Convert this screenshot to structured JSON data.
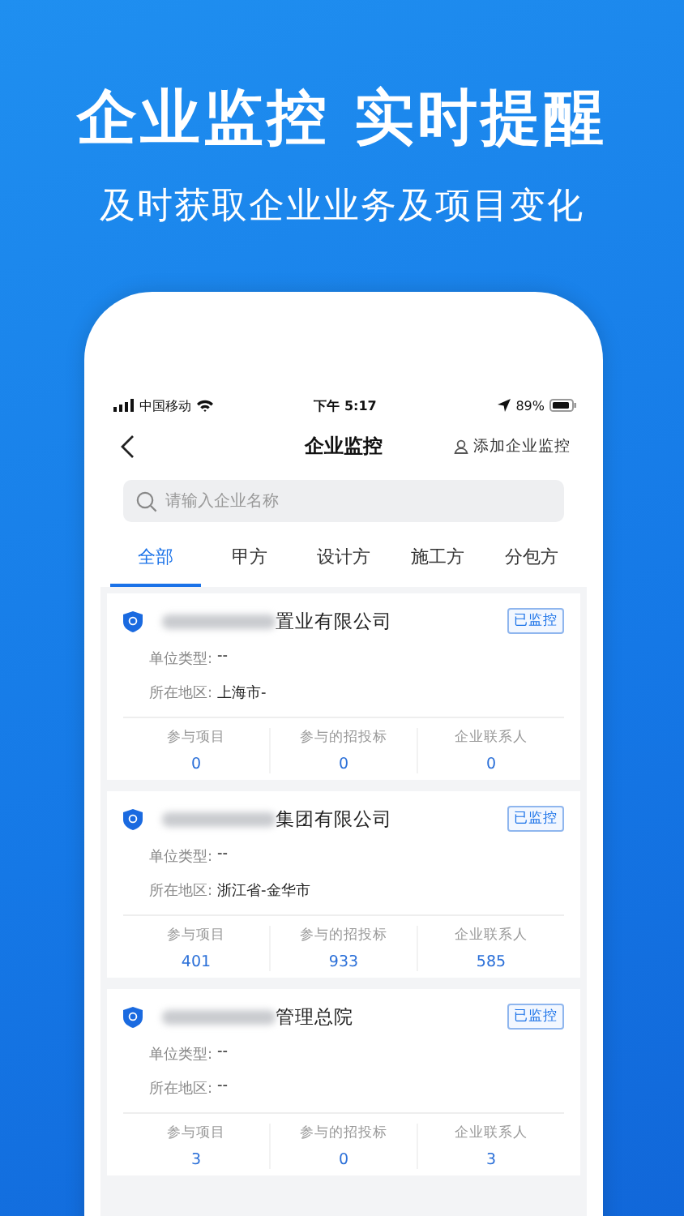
{
  "headline": "企业监控 实时提醒",
  "subtitle": "及时获取企业业务及项目变化",
  "status_bar": {
    "carrier": "中国移动",
    "time": "下午 5:17",
    "battery": "89%"
  },
  "nav": {
    "title": "企业监控",
    "action": "添加企业监控"
  },
  "search": {
    "placeholder": "请输入企业名称"
  },
  "tabs": [
    {
      "label": "全部",
      "selected": true
    },
    {
      "label": "甲方",
      "selected": false
    },
    {
      "label": "设计方",
      "selected": false
    },
    {
      "label": "施工方",
      "selected": false
    },
    {
      "label": "分包方",
      "selected": false
    }
  ],
  "companies": [
    {
      "name": "置业有限公司",
      "badge": "已监控",
      "type_label": "单位类型:",
      "type": "--",
      "region_label": "所在地区:",
      "region": "上海市-",
      "stats": [
        {
          "label": "参与项目",
          "value": "0"
        },
        {
          "label": "参与的招投标",
          "value": "0"
        },
        {
          "label": "企业联系人",
          "value": "0"
        }
      ]
    },
    {
      "name": "集团有限公司",
      "badge": "已监控",
      "type_label": "单位类型:",
      "type": "--",
      "region_label": "所在地区:",
      "region": "浙江省-金华市",
      "stats": [
        {
          "label": "参与项目",
          "value": "401"
        },
        {
          "label": "参与的招投标",
          "value": "933"
        },
        {
          "label": "企业联系人",
          "value": "585"
        }
      ]
    },
    {
      "name": "管理总院",
      "badge": "已监控",
      "type_label": "单位类型:",
      "type": "--",
      "region_label": "所在地区:",
      "region": "--",
      "stats": [
        {
          "label": "参与项目",
          "value": "3"
        },
        {
          "label": "参与的招投标",
          "value": "0"
        },
        {
          "label": "企业联系人",
          "value": "3"
        }
      ]
    }
  ]
}
